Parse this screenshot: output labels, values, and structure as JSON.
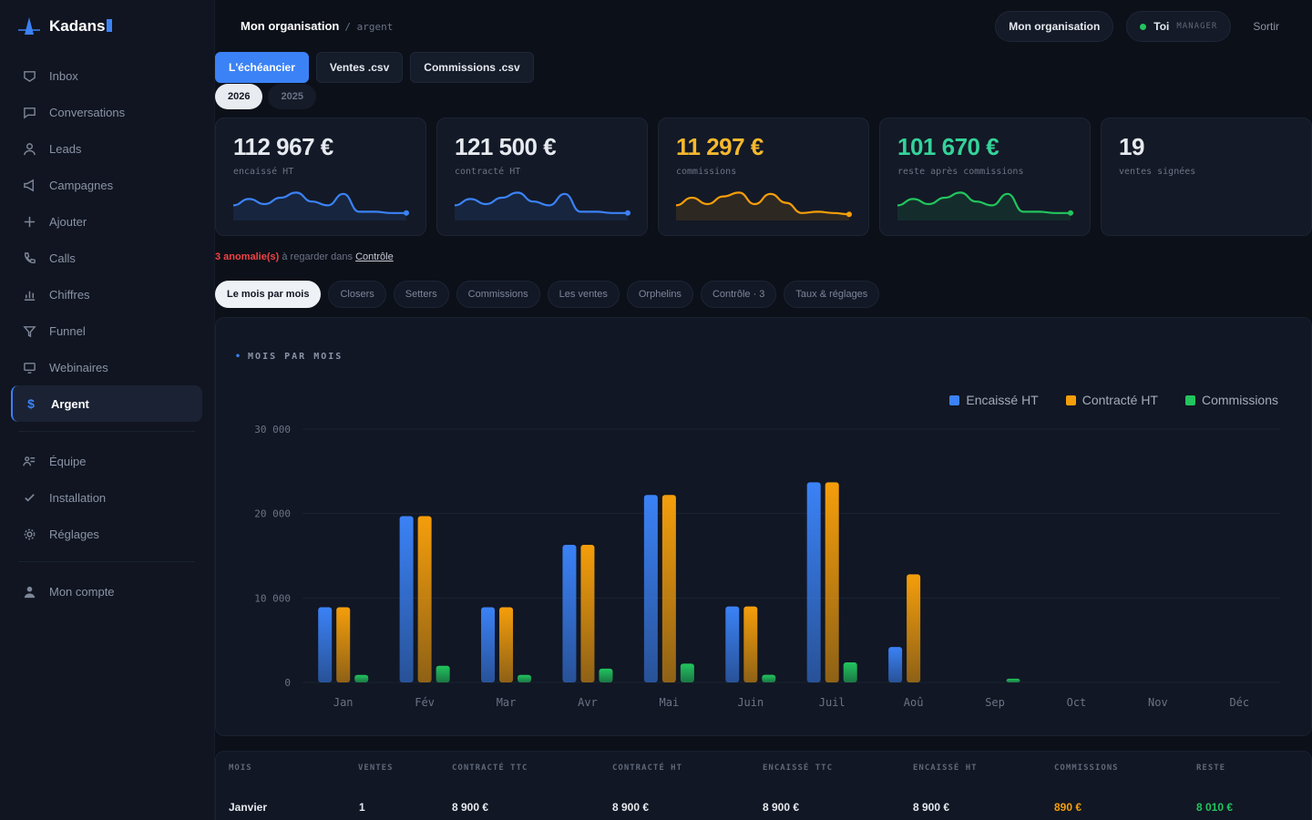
{
  "brand": {
    "name": "Kadans"
  },
  "sidebar": {
    "items": [
      {
        "label": "Inbox",
        "icon": "inbox-icon"
      },
      {
        "label": "Conversations",
        "icon": "chat-icon"
      },
      {
        "label": "Leads",
        "icon": "user-icon"
      },
      {
        "label": "Campagnes",
        "icon": "megaphone-icon"
      },
      {
        "label": "Ajouter",
        "icon": "plus-icon"
      },
      {
        "label": "Calls",
        "icon": "phone-icon"
      },
      {
        "label": "Chiffres",
        "icon": "bar-chart-icon"
      },
      {
        "label": "Funnel",
        "icon": "funnel-icon"
      },
      {
        "label": "Webinaires",
        "icon": "monitor-icon"
      },
      {
        "label": "Argent",
        "icon": "dollar-icon",
        "active": true
      }
    ],
    "items2": [
      {
        "label": "Équipe",
        "icon": "team-icon"
      },
      {
        "label": "Installation",
        "icon": "check-icon"
      },
      {
        "label": "Réglages",
        "icon": "gear-icon"
      }
    ],
    "items3": [
      {
        "label": "Mon compte",
        "icon": "account-icon"
      }
    ]
  },
  "header": {
    "org": "Mon organisation",
    "sub": "/ argent",
    "org_button": "Mon organisation",
    "user": "Toi",
    "role": "MANAGER",
    "logout": "Sortir"
  },
  "actions": {
    "schedule": "L'échéancier",
    "sales_csv": "Ventes .csv",
    "commissions_csv": "Commissions .csv"
  },
  "years": [
    "2026",
    "2025"
  ],
  "kpis": [
    {
      "value": "112 967 €",
      "label": "encaissé HT",
      "color": "#e6e9ef",
      "line": "#3b82f6"
    },
    {
      "value": "121 500 €",
      "label": "contracté HT",
      "color": "#e6e9ef",
      "line": "#3b82f6"
    },
    {
      "value": "11 297 €",
      "label": "commissions",
      "color": "#f5b82e",
      "line": "#f59e0b"
    },
    {
      "value": "101 670 €",
      "label": "reste après commissions",
      "color": "#34d399",
      "line": "#22c55e"
    },
    {
      "value": "19",
      "label": "ventes signées",
      "color": "#e6e9ef",
      "line": ""
    }
  ],
  "anomaly": {
    "count": "3 anomalie(s)",
    "text": "à regarder dans",
    "link": "Contrôle"
  },
  "tabs": [
    "Le mois par mois",
    "Closers",
    "Setters",
    "Commissions",
    "Les ventes",
    "Orphelins",
    "Contrôle · 3",
    "Taux & réglages"
  ],
  "chart_data": {
    "type": "bar",
    "title": "MOIS PAR MOIS",
    "categories": [
      "Jan",
      "Fév",
      "Mar",
      "Avr",
      "Mai",
      "Juin",
      "Juil",
      "Aoû",
      "Sep",
      "Oct",
      "Nov",
      "Déc"
    ],
    "series": [
      {
        "name": "Encaissé HT",
        "color": "#3b82f6",
        "values": [
          8900,
          19700,
          8900,
          16300,
          22200,
          9000,
          23700,
          4200,
          0,
          0,
          0,
          0
        ]
      },
      {
        "name": "Contracté HT",
        "color": "#f59e0b",
        "values": [
          8900,
          19700,
          8900,
          16300,
          22200,
          9000,
          23700,
          12800,
          0,
          0,
          0,
          0
        ]
      },
      {
        "name": "Commissions",
        "color": "#22c55e",
        "values": [
          890,
          1970,
          890,
          1630,
          2220,
          900,
          2370,
          0,
          450,
          0,
          0,
          0
        ]
      }
    ],
    "yticks": [
      "30 000",
      "20 000",
      "10 000",
      "0"
    ],
    "ylim": [
      0,
      30000
    ],
    "grid": true,
    "legend": "top-right"
  },
  "table": {
    "headers": [
      "MOIS",
      "VENTES",
      "CONTRACTÉ TTC",
      "CONTRACTÉ HT",
      "ENCAISSÉ TTC",
      "ENCAISSÉ HT",
      "COMMISSIONS",
      "RESTE"
    ],
    "rows": [
      [
        "Janvier",
        "1",
        "8 900 €",
        "8 900 €",
        "8 900 €",
        "8 900 €",
        "890 €",
        "8 010 €"
      ]
    ]
  }
}
